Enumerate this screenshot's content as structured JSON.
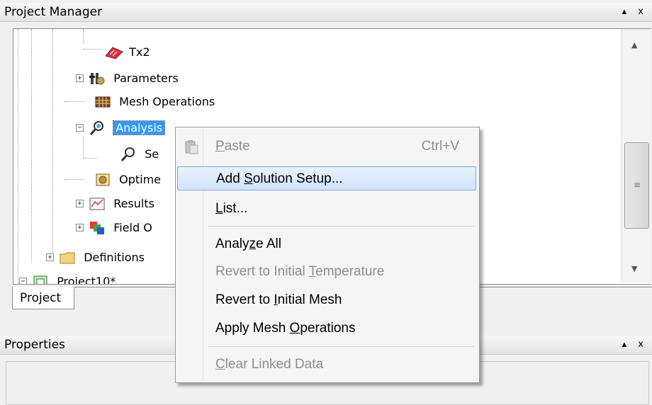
{
  "project_manager": {
    "title": "Project Manager",
    "controls": "▴ x",
    "tree": [
      {
        "label": "Tx2",
        "icon": "excitation-icon"
      },
      {
        "label": "Parameters",
        "icon": "parameters-icon"
      },
      {
        "label": "Mesh Operations",
        "icon": "mesh-operations-icon"
      },
      {
        "label": "Analysis",
        "icon": "analysis-icon",
        "selected": true
      },
      {
        "label": "Se",
        "icon": "setup-icon"
      },
      {
        "label": "Optime",
        "icon": "optimetrics-icon"
      },
      {
        "label": "Results",
        "icon": "results-icon"
      },
      {
        "label": "Field O",
        "icon": "field-overlays-icon"
      },
      {
        "label": "Definitions",
        "icon": "folder-icon"
      },
      {
        "label": "Project10*",
        "icon": "project-icon"
      }
    ],
    "tab": "Project"
  },
  "properties": {
    "title": "Properties",
    "controls": "▴ x"
  },
  "context_menu": {
    "items": [
      {
        "pre": "",
        "u": "P",
        "post": "aste",
        "shortcut": "Ctrl+V",
        "disabled": true,
        "icon": "paste-icon"
      },
      {
        "pre": "Add ",
        "u": "S",
        "post": "olution Setup...",
        "highlighted": true
      },
      {
        "pre": "",
        "u": "L",
        "post": "ist..."
      },
      {
        "pre": "Analy",
        "u": "z",
        "post": "e All"
      },
      {
        "pre": "Revert to Initial ",
        "u": "T",
        "post": "emperature",
        "disabled": true
      },
      {
        "pre": "Revert to ",
        "u": "I",
        "post": "nitial Mesh"
      },
      {
        "pre": "Apply Mesh ",
        "u": "O",
        "post": "perations"
      },
      {
        "pre": "",
        "u": "C",
        "post": "lear Linked Data",
        "disabled": true
      }
    ]
  },
  "colors": {
    "selection": "#3399ff",
    "menu_highlight": "#cfe4fb"
  }
}
